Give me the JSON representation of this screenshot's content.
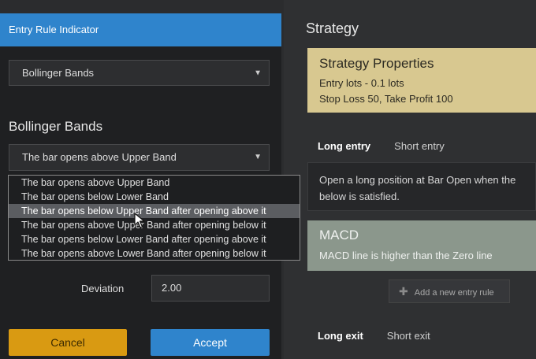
{
  "modal": {
    "title": "Entry Rule Indicator",
    "indicator_select": "Bollinger Bands",
    "section_title": "Bollinger Bands",
    "rule_select": "The bar opens above Upper Band",
    "rule_options": [
      "The bar opens above Upper Band",
      "The bar opens below Lower Band",
      "The bar opens below Upper Band after opening above it",
      "The bar opens above Upper Band after opening below it",
      "The bar opens below Lower Band after opening above it",
      "The bar opens above Lower Band after opening below it"
    ],
    "highlighted_option": 2,
    "deviation_label": "Deviation",
    "deviation_value": "2.00",
    "cancel_label": "Cancel",
    "accept_label": "Accept"
  },
  "strategy": {
    "title": "Strategy",
    "properties_title": "Strategy Properties",
    "properties_line1": "Entry lots - 0.1 lots",
    "properties_line2": "Stop Loss 50, Take Profit 100",
    "entry_tabs": [
      "Long entry",
      "Short entry"
    ],
    "entry_desc_line1": "Open a long position at Bar Open when the",
    "entry_desc_line2": "below is satisfied.",
    "macd_title": "MACD",
    "macd_text": "MACD line is higher than the Zero line",
    "add_rule_label": "Add a new entry rule",
    "exit_tabs": [
      "Long exit",
      "Short exit"
    ]
  },
  "colors": {
    "header_blue": "#2f84cc",
    "cancel_orange": "#d99a12",
    "properties_card": "#d8c890",
    "macd_card": "#8b978c"
  }
}
